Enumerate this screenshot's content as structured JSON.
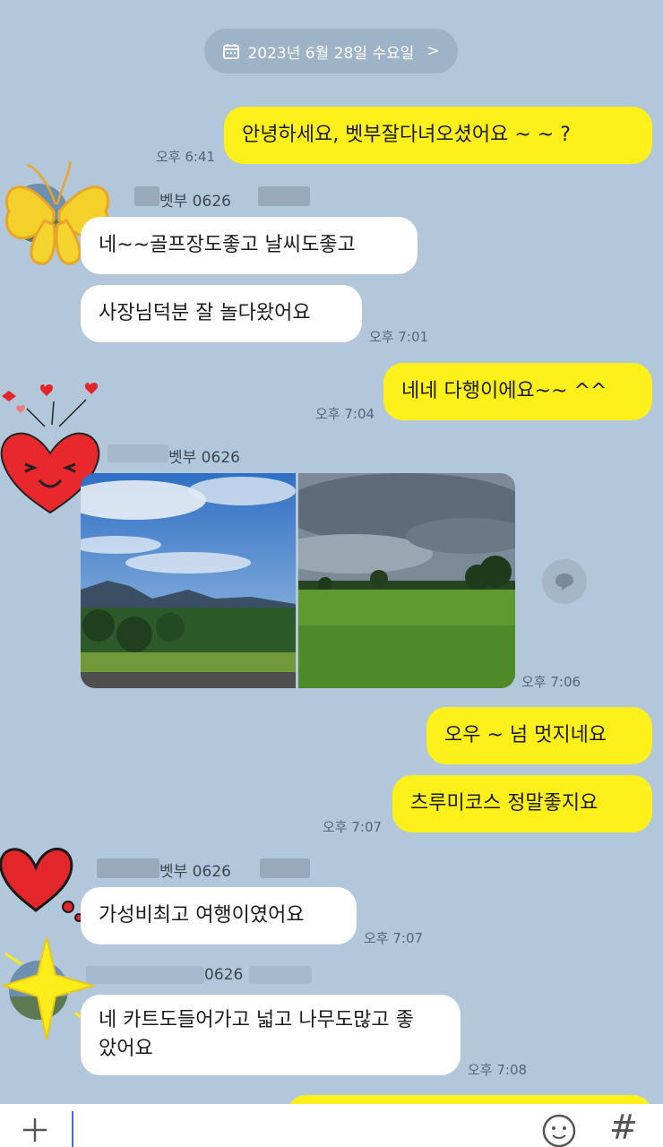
{
  "date_header": {
    "label": "2023년 6월 28일 수요일",
    "chevron": ">"
  },
  "messages": [
    {
      "side": "me",
      "text": "안녕하세요,  벳부잘다녀오셨어요 ~ ~ ?",
      "time": "오후 6:41"
    },
    {
      "side": "other",
      "sender": "벳부 0626",
      "text": "네~~골프장도좋고 날씨도좋고"
    },
    {
      "side": "other",
      "text": "사장님덕분 잘 놀다왔어요",
      "time": "오후 7:01"
    },
    {
      "side": "me",
      "text": "네네 다행이에요~~  ^^",
      "time": "오후 7:04"
    },
    {
      "side": "other",
      "sender": "벳부 0626",
      "time": "오후 7:06"
    },
    {
      "side": "me",
      "text": "오우 ~  넘 멋지네요"
    },
    {
      "side": "me",
      "text": "츠루미코스 정말좋지요",
      "time": "오후 7:07"
    },
    {
      "side": "other",
      "sender": "벳부 0626",
      "text": "가성비최고 여행이였어요",
      "time": "오후 7:07"
    },
    {
      "side": "other",
      "sender": "0626",
      "text": "네 카트도들어가고 넓고 나무도많고 좋았어요",
      "time": "오후 7:08"
    }
  ],
  "icons": {
    "calendar": "calendar-icon",
    "share": "speech-bubble-icon",
    "plus": "plus-icon",
    "emoji": "emoji-icon",
    "hash": "#"
  },
  "colors": {
    "background": "#b2c7da",
    "my_bubble": "#fef01b",
    "other_bubble": "#ffffff"
  }
}
